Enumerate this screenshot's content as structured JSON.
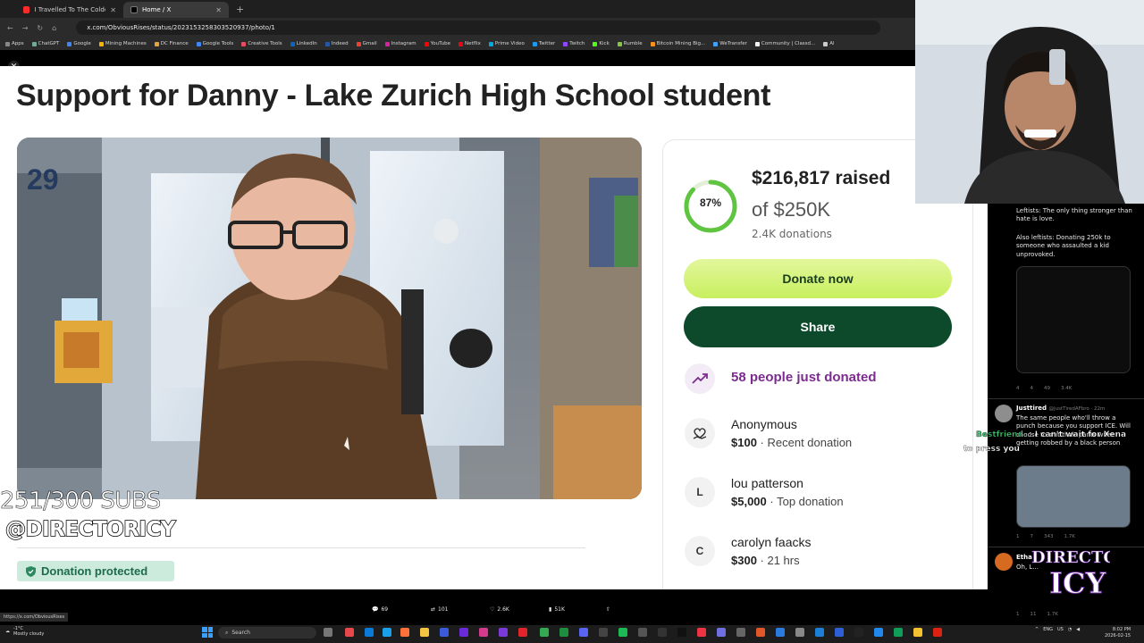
{
  "browser": {
    "tabs": [
      {
        "label": "I Travelled To The Coldest City",
        "active": false
      },
      {
        "label": "Home / X",
        "active": true
      }
    ],
    "url": "x.com/ObviousRises/status/2023153258303520937/photo/1",
    "status_url": "https://x.com/ObviousRises",
    "bookmarks": [
      "Apps",
      "ChatGPT",
      "Google",
      "Mining Machines",
      "DC Finance",
      "Google Tools",
      "Creative Tools",
      "LinkedIn",
      "Indeed",
      "Gmail",
      "Instagram",
      "YouTube",
      "Netflix",
      "Prime Video",
      "Twitter",
      "Twitch",
      "Kick",
      "Rumble",
      "Bitcoin Mining Big...",
      "WeTransfer",
      "Community | Classd...",
      "Al"
    ]
  },
  "fundraiser": {
    "title": "Support for Danny - Lake Zurich High School student",
    "photo_door_number": "29",
    "progress_percent": "87%",
    "progress_fraction": 0.87,
    "raised_amount": "$216,817",
    "raised_word": "raised",
    "goal": "of $250K",
    "donations_count": "2.4K donations",
    "donate_label": "Donate now",
    "share_label": "Share",
    "recent_activity": "58 people just donated",
    "donors": [
      {
        "initial": "",
        "name": "Anonymous",
        "amount": "$100",
        "note": "Recent donation"
      },
      {
        "initial": "L",
        "name": "lou patterson",
        "amount": "$5,000",
        "note": "Top donation"
      },
      {
        "initial": "C",
        "name": "carolyn faacks",
        "amount": "$300",
        "note": "21 hrs"
      }
    ],
    "protected_label": "Donation protected"
  },
  "tweet_actions": {
    "replies": "69",
    "reposts": "101",
    "likes": "2.6K",
    "views": "51K"
  },
  "sidebar_tweets": {
    "tweet1_lines": [
      "Leftists: The only thing stronger than hate is love.",
      "Also leftists: Donating 250k to someone who assaulted a kid unprovoked."
    ],
    "tweet1_stats": [
      "4",
      "4",
      "49",
      "3.4K"
    ],
    "tweet2_name": "Justtired",
    "tweet2_handle": "@JustTiredAFbro · 22m",
    "tweet2_text": "The same people who'll throw a punch because you support ICE. Will choose to shit their pants when getting robbed by a black person",
    "tweet2_stats": [
      "1",
      "7",
      "343",
      "1.7K"
    ],
    "tweet3_name": "Etha",
    "tweet3_text": "Oh, L...",
    "tweet3_stats": [
      "1",
      "11",
      "1.7K"
    ]
  },
  "overlays": {
    "subs_counter": "251/300 SUBS",
    "handle": "@DIRECTORICY",
    "chat_user": "Bestfriend",
    "chat_message": ": I can't wait for Xena",
    "chat_subtext": "to press you",
    "logo_text": "DIRECTOR ICY"
  },
  "taskbar": {
    "weather_temp": "-1°C",
    "weather_desc": "Mostly cloudy",
    "search_label": "Search",
    "lang": "ENG",
    "region": "US",
    "time": "8:02 PM",
    "date": "2026-02-15"
  },
  "colors": {
    "donate_green": "#c8ef5e",
    "share_green": "#0d4a2c",
    "purple_accent": "#7b2c8e",
    "ring_green": "#5fc43f"
  }
}
